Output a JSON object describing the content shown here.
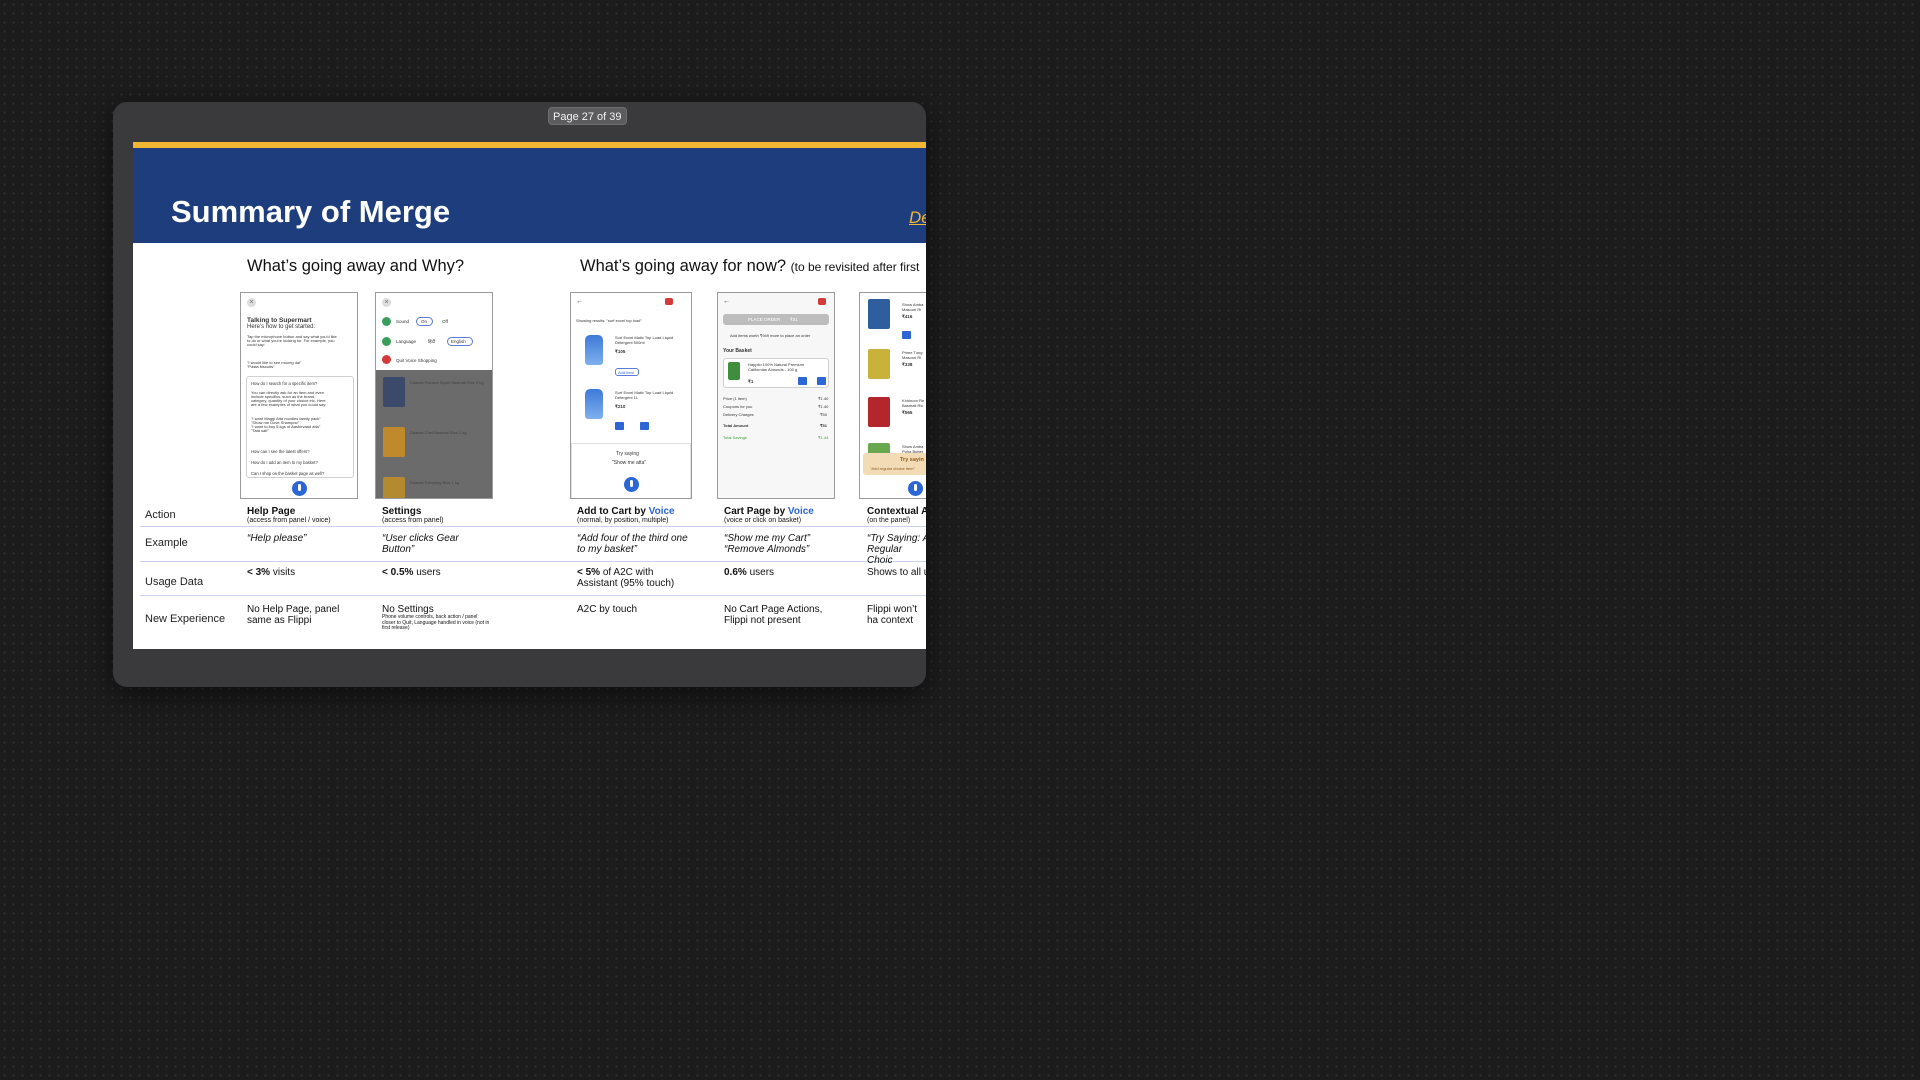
{
  "viewer": {
    "page_indicator": "Page 27 of 39"
  },
  "slide": {
    "title": "Summary of Merge",
    "link_text": "De",
    "heading_left": "What’s going away and Why?",
    "heading_right": "What’s going away for now?",
    "heading_right_note": "(to be revisited after first",
    "row_labels": {
      "action": "Action",
      "example": "Example",
      "usage": "Usage Data",
      "new_exp": "New Experience"
    },
    "columns": [
      {
        "action_title": "Help Page",
        "action_sub": "(access from panel / voice)",
        "example": "“Help please”",
        "usage_bold": "< 3%",
        "usage_rest": " visits",
        "new_exp": "No Help Page, panel same as Flippi"
      },
      {
        "action_title": "Settings",
        "action_sub": "(access from panel)",
        "example": "“User clicks Gear Button”",
        "usage_bold": "< 0.5%",
        "usage_rest": " users",
        "new_exp": "No Settings",
        "new_exp_micro": "Phone volume controls, back action / panel closer to Quit, Language handled in voice (not in first release)"
      },
      {
        "action_title": "Add to Cart by ",
        "action_voice": "Voice",
        "action_sub": "(normal, by position, multiple)",
        "example": "“Add four of the third one to my basket”",
        "usage_bold": "< 5%",
        "usage_rest": " of A2C with Assistant (95% touch)",
        "new_exp": "A2C by touch"
      },
      {
        "action_title": "Cart Page by ",
        "action_voice": "Voice",
        "action_sub": "(voice or click on basket)",
        "example": "“Show me my Cart” “Remove Almonds”",
        "usage_bold": "0.6%",
        "usage_rest": " users",
        "new_exp": "No Cart Page Actions, Flippi not present"
      },
      {
        "action_title": "Contextual A",
        "action_sub": "(on the panel)",
        "example": "“Try Saying: A Regular Choic",
        "usage_plain": "Shows to all u",
        "new_exp": "Flippi won’t ha context"
      }
    ],
    "phones": {
      "help": {
        "title": "Talking to Supermart",
        "subtitle": "Here's how to get started:",
        "body": [
          "Tap the microphone button and say what you'd like",
          "to do or what you're looking for. For example, you",
          "could say:"
        ],
        "quote": [
          "\"I would like to see moong dal\"",
          "\"Pasta biscuits\""
        ],
        "q1": "How do I search for a specific item?",
        "a1": [
          "You can directly ask for an item and even",
          "include specifics, such as the brand,",
          "category, quantity of your choice etc. Here",
          "are a few examples of what you could say:"
        ],
        "a1q": [
          "\"I want Maggi Atta noodles family pack\"",
          "\"Show me Dove Shampoo\"",
          "\"I want to buy 5 kgs of Aashirvaad atta\"",
          "\"Tata salt\""
        ],
        "q2": "How can I see the latest offers?",
        "q3": "How do I add an item to my basket?",
        "q4": "Can I shop on the basket page as well?"
      },
      "settings": {
        "sound": "Sound",
        "on": "On",
        "off": "Off",
        "language": "Language",
        "lang_hi": "हिंदी",
        "lang_en": "English",
        "quit": "Quit Voice Shopping",
        "items": [
          "Daawat Rozana Super Basmati Rice 5 kg",
          "Daawat Chef Basmati Rice 1 kg",
          "Daawat Everyday Rice 1 kg"
        ]
      },
      "a2c": {
        "showing": "Showing results: \"surf excel top load\"",
        "p1": [
          "Surf Excel Matic Top Load Liquid",
          "Detergent 500ml"
        ],
        "p1_price": "₹105",
        "p2": [
          "Surf Excel Matic Top Load Liquid",
          "Detergent 1L"
        ],
        "p2_price": "₹210",
        "add": "Add Item",
        "try": "Try saying",
        "try_q": "\"Show me atta\""
      },
      "cart": {
        "place": "PLACE ORDER",
        "place_amt": "₹51",
        "add_more": "Add items worth ₹949 more to place an order",
        "basket": "Your Basket",
        "item": [
          "Happilo 100% Natural Premium",
          "Californian Almonds - 100 g"
        ],
        "item_price": "₹1",
        "rows": [
          [
            "Price (1 item)",
            "₹1.40"
          ],
          [
            "Coupons for you",
            "₹1.40"
          ],
          [
            "Delivery Charges",
            "₹50"
          ],
          [
            "Total Amount",
            "₹51"
          ],
          [
            "Total Savings",
            "₹1.44"
          ]
        ]
      },
      "ctx": {
        "p1": [
          "Show Amba",
          "Masoori Ri"
        ],
        "p1_price": "₹416",
        "p2": [
          "Prime Tung",
          "Masoori Ri"
        ],
        "p2_price": "₹338",
        "p3": [
          "Kohinoor Re",
          "Basmati Ric"
        ],
        "p3_price": "₹565",
        "p4": [
          "Show Amba",
          "Poha Buttet"
        ],
        "try": "Try sayin",
        "try_sub": "\"Add regular choice item\""
      }
    }
  }
}
